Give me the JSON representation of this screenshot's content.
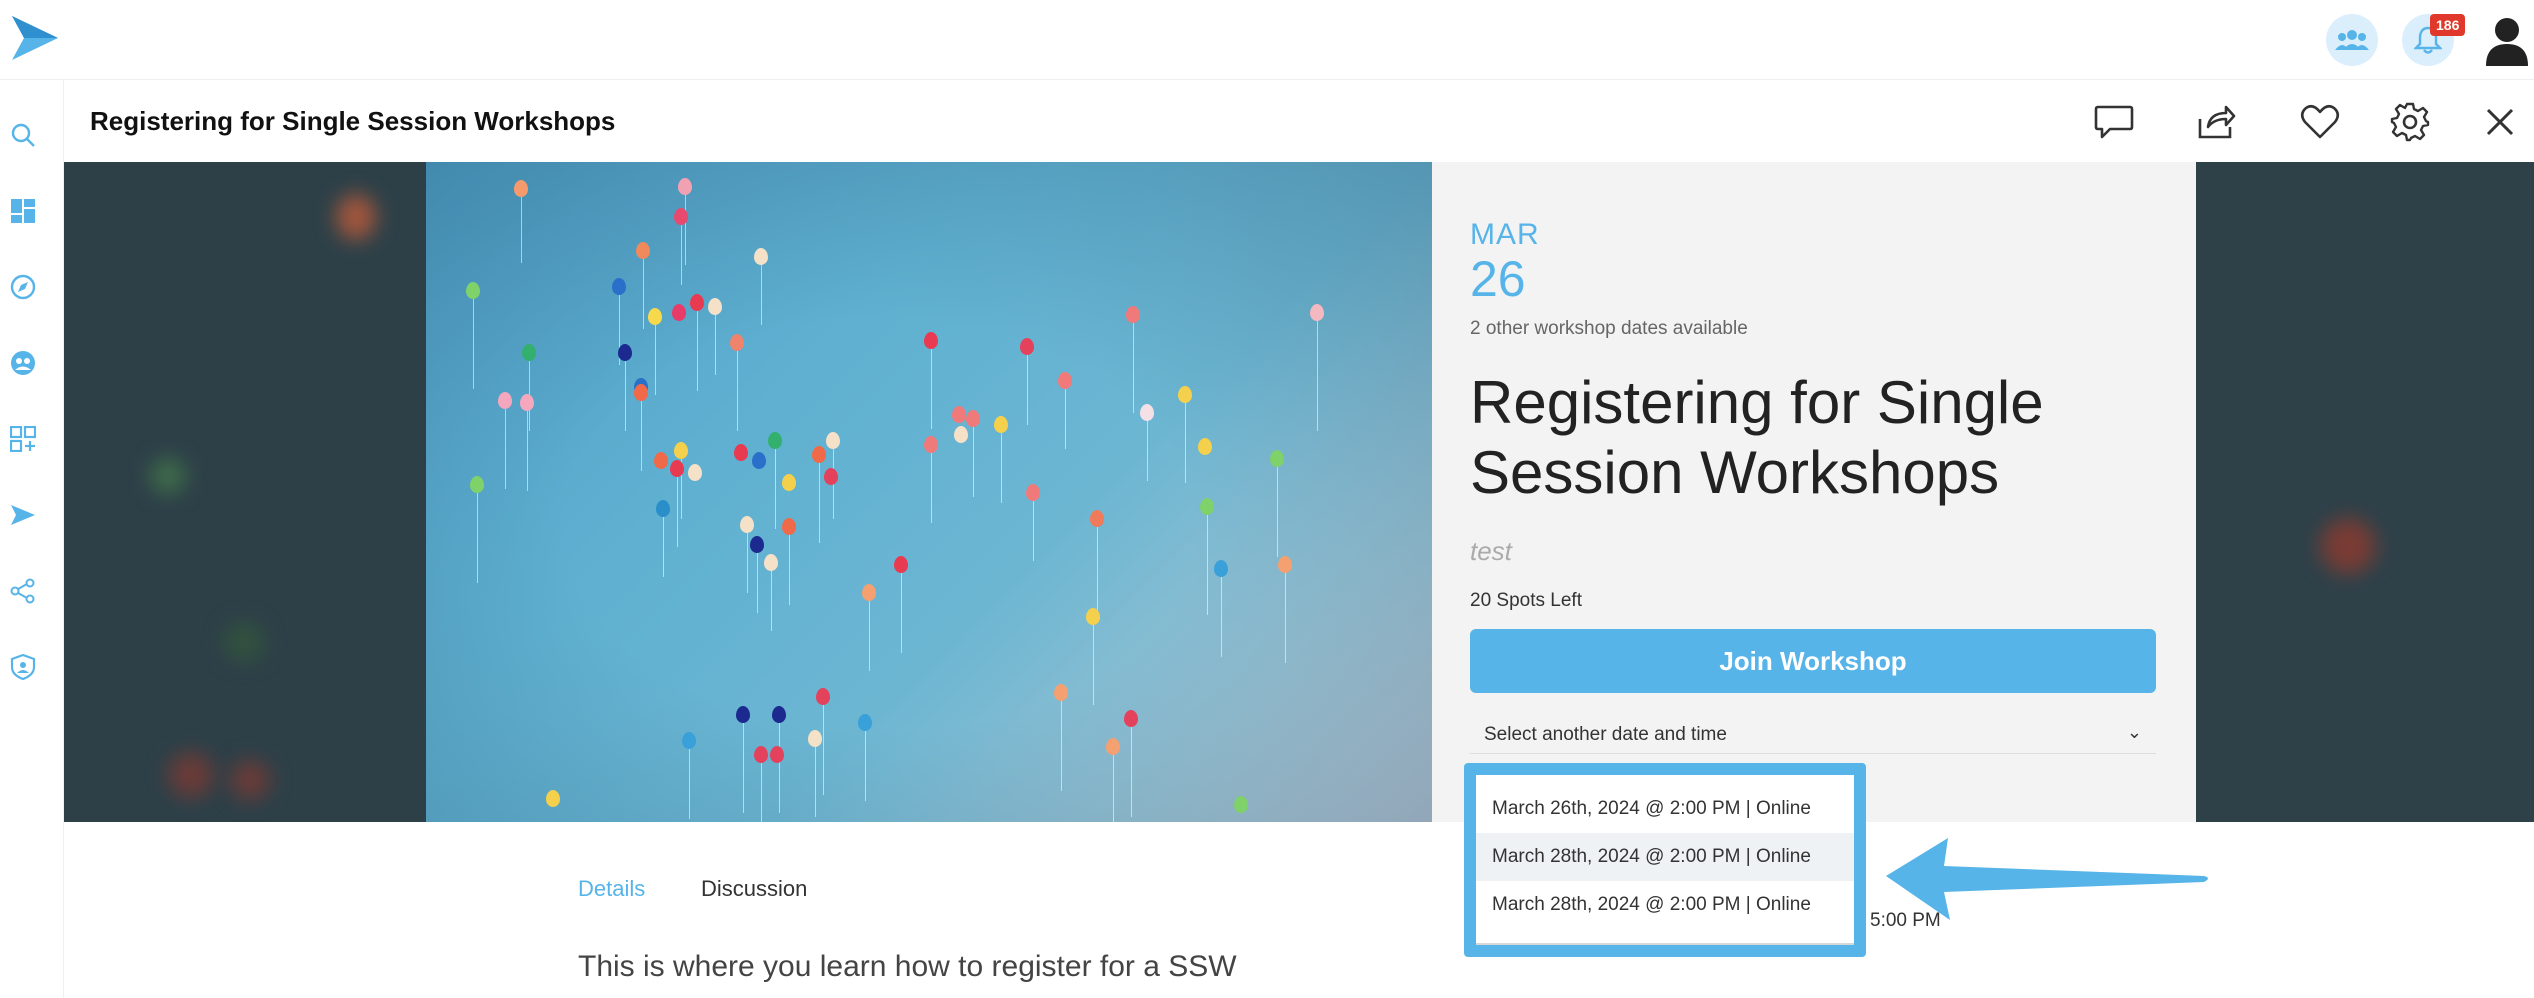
{
  "header": {
    "notification_count": "186"
  },
  "panel": {
    "title": "Registering for Single Session Workshops"
  },
  "event": {
    "month": "MAR",
    "day": "26",
    "other_dates": "2 other workshop dates available",
    "title": "Registering for Single Session Workshops",
    "description": "test",
    "spots_left": "20 Spots Left",
    "join_label": "Join Workshop",
    "select_label": "Select another date and time",
    "options": [
      "March 26th, 2024 @ 2:00 PM | Online",
      "March 28th, 2024 @ 2:00 PM | Online",
      "March 28th, 2024 @ 2:00 PM | Online"
    ]
  },
  "tabs": {
    "details": "Details",
    "discussion": "Discussion"
  },
  "content": {
    "lead": "This is where you learn how to register for a SSW",
    "time_fragment": "5:00 PM"
  },
  "colors": {
    "accent": "#56b4e9",
    "badge": "#e0392b"
  }
}
